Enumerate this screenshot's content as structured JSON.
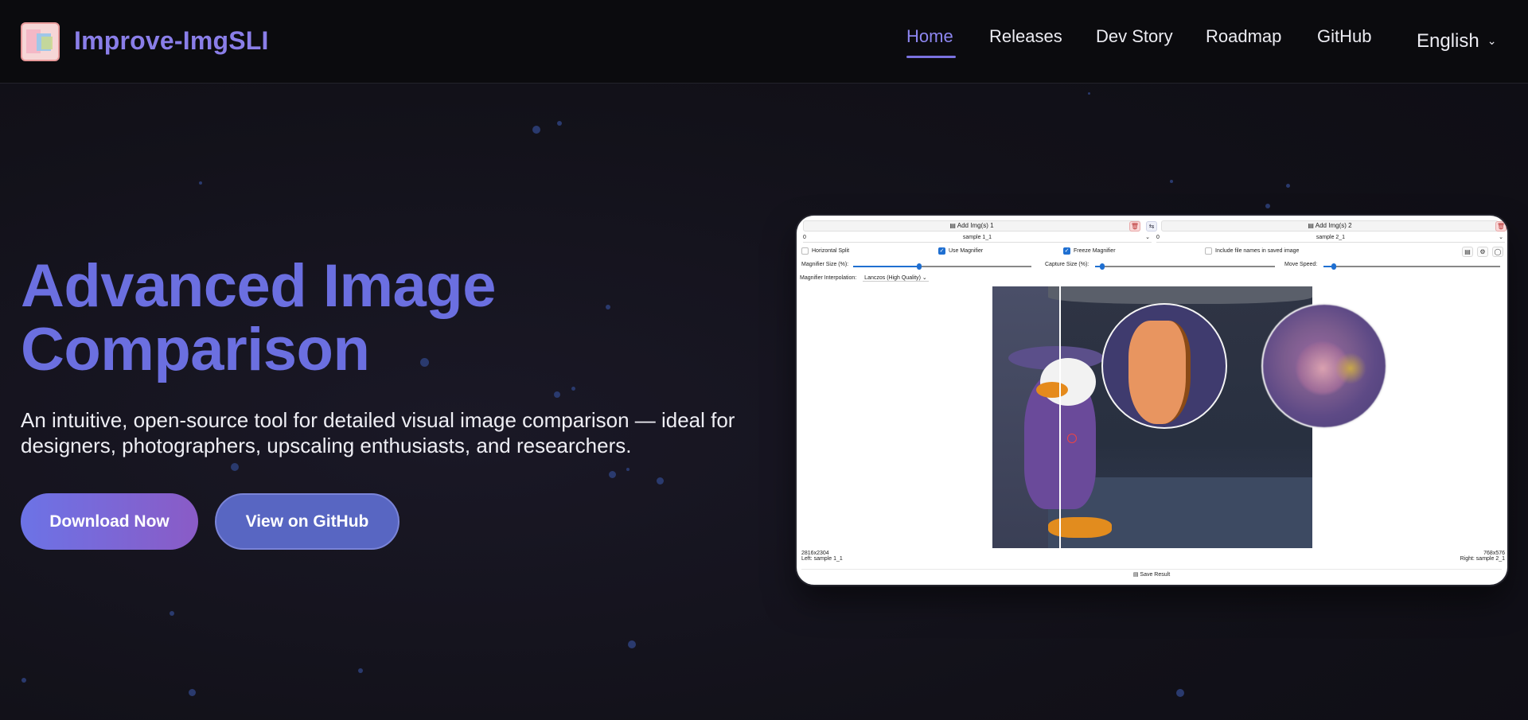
{
  "header": {
    "brand": "Improve-ImgSLI",
    "nav": [
      {
        "label": "Home",
        "active": true
      },
      {
        "label": "Releases"
      },
      {
        "label": "Dev Story"
      },
      {
        "label": "Roadmap"
      },
      {
        "label": "GitHub"
      }
    ],
    "language": "English"
  },
  "hero": {
    "title_line1": "Advanced Image",
    "title_line2": "Comparison",
    "description": "An intuitive, open-source tool for detailed visual image comparison — ideal for designers, photographers, upscaling enthusiasts, and researchers.",
    "primary_button": "Download Now",
    "secondary_button": "View on GitHub"
  },
  "screenshot": {
    "add_left": "Add Img(s) 1",
    "add_right": "Add Img(s) 2",
    "left_index": "0",
    "left_name": "sample 1_1",
    "right_index": "0",
    "right_name": "sample 2_1",
    "opt_horizontal_split": "Horizontal Split",
    "opt_use_magnifier": "Use Magnifier",
    "opt_freeze_magnifier": "Freeze Magnifier",
    "opt_include_names": "Include file names in saved image",
    "magnifier_size_label": "Magnifier Size (%):",
    "capture_size_label": "Capture Size (%):",
    "move_speed_label": "Move Speed:",
    "interp_label": "Magnifier Interpolation:",
    "interp_value": "Lanczos (High Quality)",
    "left_resolution": "2816x2304",
    "left_caption": "Left: sample 1_1",
    "right_resolution": "768x576",
    "right_caption": "Right: sample 2_1",
    "save_label": "Save Result"
  },
  "colors": {
    "accent": "#7a72e0",
    "title_start": "#6b6fe0",
    "title_end": "#9a5cc6",
    "background": "#121119"
  }
}
